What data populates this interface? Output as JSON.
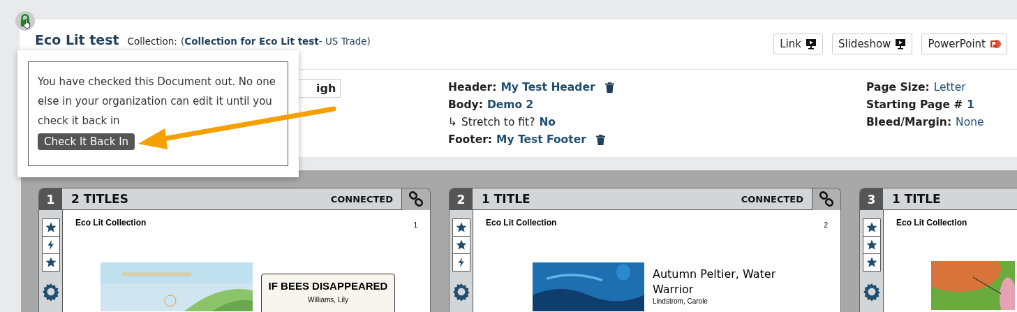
{
  "document": {
    "title": "Eco Lit test",
    "collection_label": "Collection:",
    "collection": "(**Collection for Eco Lit test**- US Trade)",
    "locked": true
  },
  "actions": [
    {
      "label": "Link",
      "kind": "present"
    },
    {
      "label": "Slideshow",
      "kind": "present"
    },
    {
      "label": "PowerPoint",
      "kind": "powerpoint"
    }
  ],
  "partial_field": "igh",
  "layout": [
    {
      "label": "Header:",
      "value": "My Test Header",
      "kind": "deletable"
    },
    {
      "label": "Body:",
      "value": "Demo 2",
      "kind": "plain"
    },
    {
      "label": "Stretch to fit?",
      "value": "No",
      "kind": "sub",
      "icon": "↳"
    },
    {
      "label": "Footer:",
      "value": "My Test Footer",
      "kind": "deletable"
    }
  ],
  "page_settings": [
    {
      "label": "Page Size:",
      "value": "Letter",
      "kind": "normal"
    },
    {
      "label": "Starting Page #",
      "value": "1",
      "kind": "bold"
    },
    {
      "label": "Bleed/Margin:",
      "value": "None",
      "kind": "normal"
    }
  ],
  "popover": {
    "message": "You have checked this Document out. No one else in your organization can edit it until you check it back in",
    "button": "Check It Back In"
  },
  "pages": [
    {
      "number": "1",
      "count": "2 TITLES",
      "status": "CONNECTED",
      "tools": [
        {
          "kind": "star"
        },
        {
          "kind": "bolt"
        },
        {
          "kind": "star"
        }
      ],
      "collection": "Eco Lit Collection",
      "page_no": "1",
      "book": {
        "kind": "boxed",
        "title": "IF BEES DISAPPEARED",
        "author": "Williams, Lily"
      }
    },
    {
      "number": "2",
      "count": "1 TITLE",
      "status": "CONNECTED",
      "tools": [
        {
          "kind": "star"
        },
        {
          "kind": "star"
        },
        {
          "kind": "bolt"
        }
      ],
      "collection": "Eco Lit Collection",
      "page_no": "2",
      "book": {
        "kind": "plain",
        "title": "Autumn Peltier, Water Warrior",
        "author": "Lindstrom, Carole"
      }
    },
    {
      "number": "3",
      "count": "1 TITLE",
      "tools": [
        {
          "kind": "star"
        },
        {
          "kind": "star"
        },
        {
          "kind": "star"
        }
      ],
      "collection": "Eco Lit Collection",
      "book": {
        "kind": "cover_only"
      }
    }
  ]
}
